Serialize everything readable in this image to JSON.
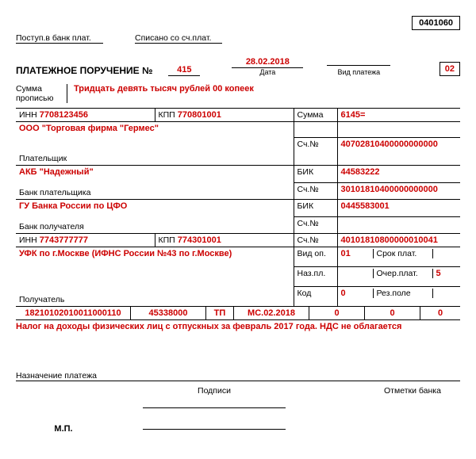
{
  "form_code": "0401060",
  "header": {
    "bank_in": "Поступ.в банк плат.",
    "written_off": "Списано со сч.плат."
  },
  "title": "ПЛАТЕЖНОЕ ПОРУЧЕНИЕ №",
  "number": "415",
  "date": "28.02.2018",
  "date_label": "Дата",
  "payment_type_label": "Вид платежа",
  "status": "02",
  "amount_words_label": "Сумма\nпрописью",
  "amount_words": "Тридцать девять тысяч рублей 00 копеек",
  "payer": {
    "inn_label": "ИНН",
    "inn": "7708123456",
    "kpp_label": "КПП",
    "kpp": "770801001",
    "sum_label": "Сумма",
    "sum": "6145=",
    "name": "ООО \"Торговая фирма \"Гермес\"",
    "acct_label": "Сч.№",
    "acct": "40702810400000000000",
    "label": "Плательщик"
  },
  "payer_bank": {
    "name": "АКБ \"Надежный\"",
    "bik_label": "БИК",
    "bik": "44583222",
    "acct_label": "Сч.№",
    "acct": "30101810400000000000",
    "label": "Банк плательщика"
  },
  "payee_bank": {
    "name": "ГУ Банка России по ЦФО",
    "bik_label": "БИК",
    "bik": "0445583001",
    "acct_label": "Сч.№",
    "acct": "",
    "label": "Банк получателя"
  },
  "payee": {
    "inn_label": "ИНН",
    "inn": "7743777777",
    "kpp_label": "КПП",
    "kpp": "774301001",
    "acct_label": "Сч.№",
    "acct": "40101810800000010041",
    "name": "УФК по г.Москве (ИФНС России №43 по г.Москве)",
    "label": "Получатель"
  },
  "grid": {
    "vid_op_label": "Вид оп.",
    "vid_op": "01",
    "srok_label": "Срок плат.",
    "naz_pl_label": "Наз.пл.",
    "ocher_label": "Очер.плат.",
    "ocher": "5",
    "kod_label": "Код",
    "kod": "0",
    "rez_label": "Рез.поле"
  },
  "tax_row": {
    "kbk": "18210102010011000110",
    "oktmo": "45338000",
    "basis": "ТП",
    "period": "МС.02.2018",
    "doc_no": "0",
    "doc_date": "0",
    "type": "0"
  },
  "purpose": "Налог на доходы физических лиц с отпускных за февраль 2017 года. НДС не облагается",
  "purpose_label": "Назначение платежа",
  "signatures_label": "Подписи",
  "bank_marks_label": "Отметки банка",
  "mp": "М.П."
}
